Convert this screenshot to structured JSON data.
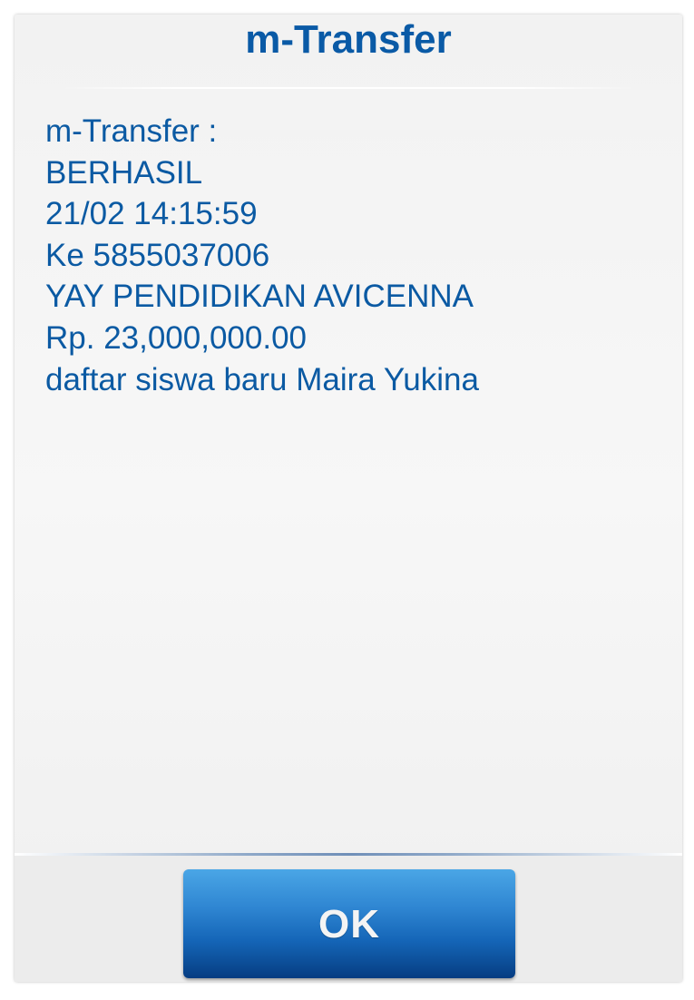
{
  "dialog": {
    "title": "m-Transfer",
    "message_lines": [
      "m-Transfer :",
      "BERHASIL",
      "21/02 14:15:59",
      "Ke 5855037006",
      "YAY PENDIDIKAN AVICENNA",
      "Rp. 23,000,000.00",
      "daftar siswa baru Maira Yukina"
    ],
    "ok_label": "OK"
  },
  "colors": {
    "title_text": "#0a5aa6",
    "message_text": "#0b5aa3",
    "button_top": "#4aa6e6",
    "button_bottom": "#063d82",
    "button_text": "#f4f4f4",
    "dialog_background": "#f2f2f2"
  }
}
